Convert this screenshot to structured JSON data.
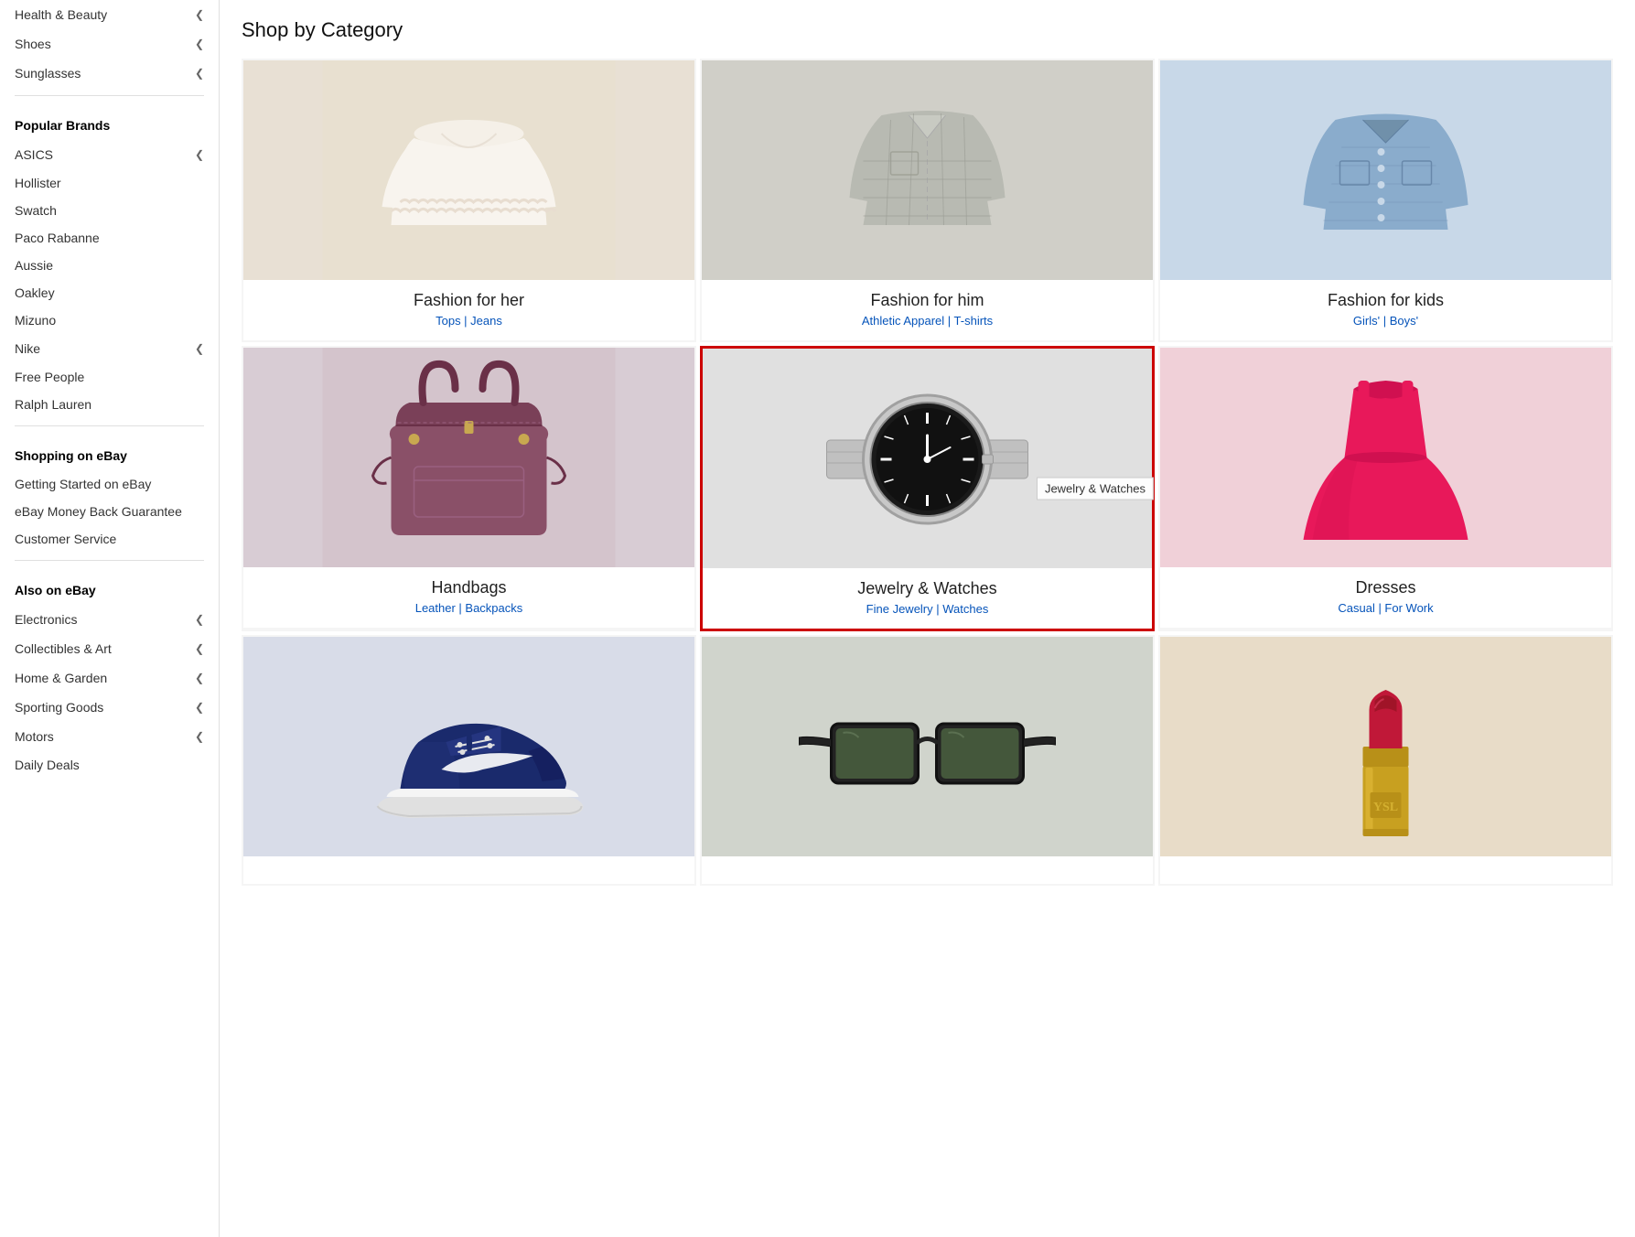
{
  "sidebar": {
    "top_items": [
      {
        "label": "Health & Beauty",
        "hasChevron": true
      },
      {
        "label": "Shoes",
        "hasChevron": true
      },
      {
        "label": "Sunglasses",
        "hasChevron": true
      }
    ],
    "popular_brands_header": "Popular Brands",
    "popular_brands": [
      {
        "label": "ASICS",
        "hasChevron": true
      },
      {
        "label": "Hollister",
        "hasChevron": false
      },
      {
        "label": "Swatch",
        "hasChevron": false
      },
      {
        "label": "Paco Rabanne",
        "hasChevron": false
      },
      {
        "label": "Aussie",
        "hasChevron": false
      },
      {
        "label": "Oakley",
        "hasChevron": false
      },
      {
        "label": "Mizuno",
        "hasChevron": false
      },
      {
        "label": "Nike",
        "hasChevron": true
      },
      {
        "label": "Free People",
        "hasChevron": false
      },
      {
        "label": "Ralph Lauren",
        "hasChevron": false
      }
    ],
    "shopping_header": "Shopping on eBay",
    "shopping_items": [
      {
        "label": "Getting Started on eBay"
      },
      {
        "label": "eBay Money Back Guarantee"
      },
      {
        "label": "Customer Service"
      }
    ],
    "also_header": "Also on eBay",
    "also_items": [
      {
        "label": "Electronics",
        "hasChevron": true
      },
      {
        "label": "Collectibles & Art",
        "hasChevron": true
      },
      {
        "label": "Home & Garden",
        "hasChevron": true
      },
      {
        "label": "Sporting Goods",
        "hasChevron": true
      },
      {
        "label": "Motors",
        "hasChevron": true
      },
      {
        "label": "Daily Deals",
        "hasChevron": false
      }
    ]
  },
  "main": {
    "page_title": "Shop by Category",
    "categories": [
      {
        "id": "fashion-her",
        "title": "Fashion for her",
        "subtitle": "Tops | Jeans",
        "highlighted": false,
        "tooltip": null
      },
      {
        "id": "fashion-him",
        "title": "Fashion for him",
        "subtitle": "Athletic Apparel | T-shirts",
        "highlighted": false,
        "tooltip": null
      },
      {
        "id": "fashion-kids",
        "title": "Fashion for kids",
        "subtitle": "Girls' | Boys'",
        "highlighted": false,
        "tooltip": null
      },
      {
        "id": "handbags",
        "title": "Handbags",
        "subtitle": "Leather | Backpacks",
        "highlighted": false,
        "tooltip": null
      },
      {
        "id": "jewelry-watches",
        "title": "Jewelry & Watches",
        "subtitle": "Fine Jewelry | Watches",
        "highlighted": true,
        "tooltip": "Jewelry & Watches"
      },
      {
        "id": "dresses",
        "title": "Dresses",
        "subtitle": "Casual | For Work",
        "highlighted": false,
        "tooltip": null
      },
      {
        "id": "shoes",
        "title": "",
        "subtitle": "",
        "highlighted": false,
        "tooltip": null
      },
      {
        "id": "sunglasses",
        "title": "",
        "subtitle": "",
        "highlighted": false,
        "tooltip": null
      },
      {
        "id": "beauty",
        "title": "",
        "subtitle": "",
        "highlighted": false,
        "tooltip": null
      }
    ]
  }
}
